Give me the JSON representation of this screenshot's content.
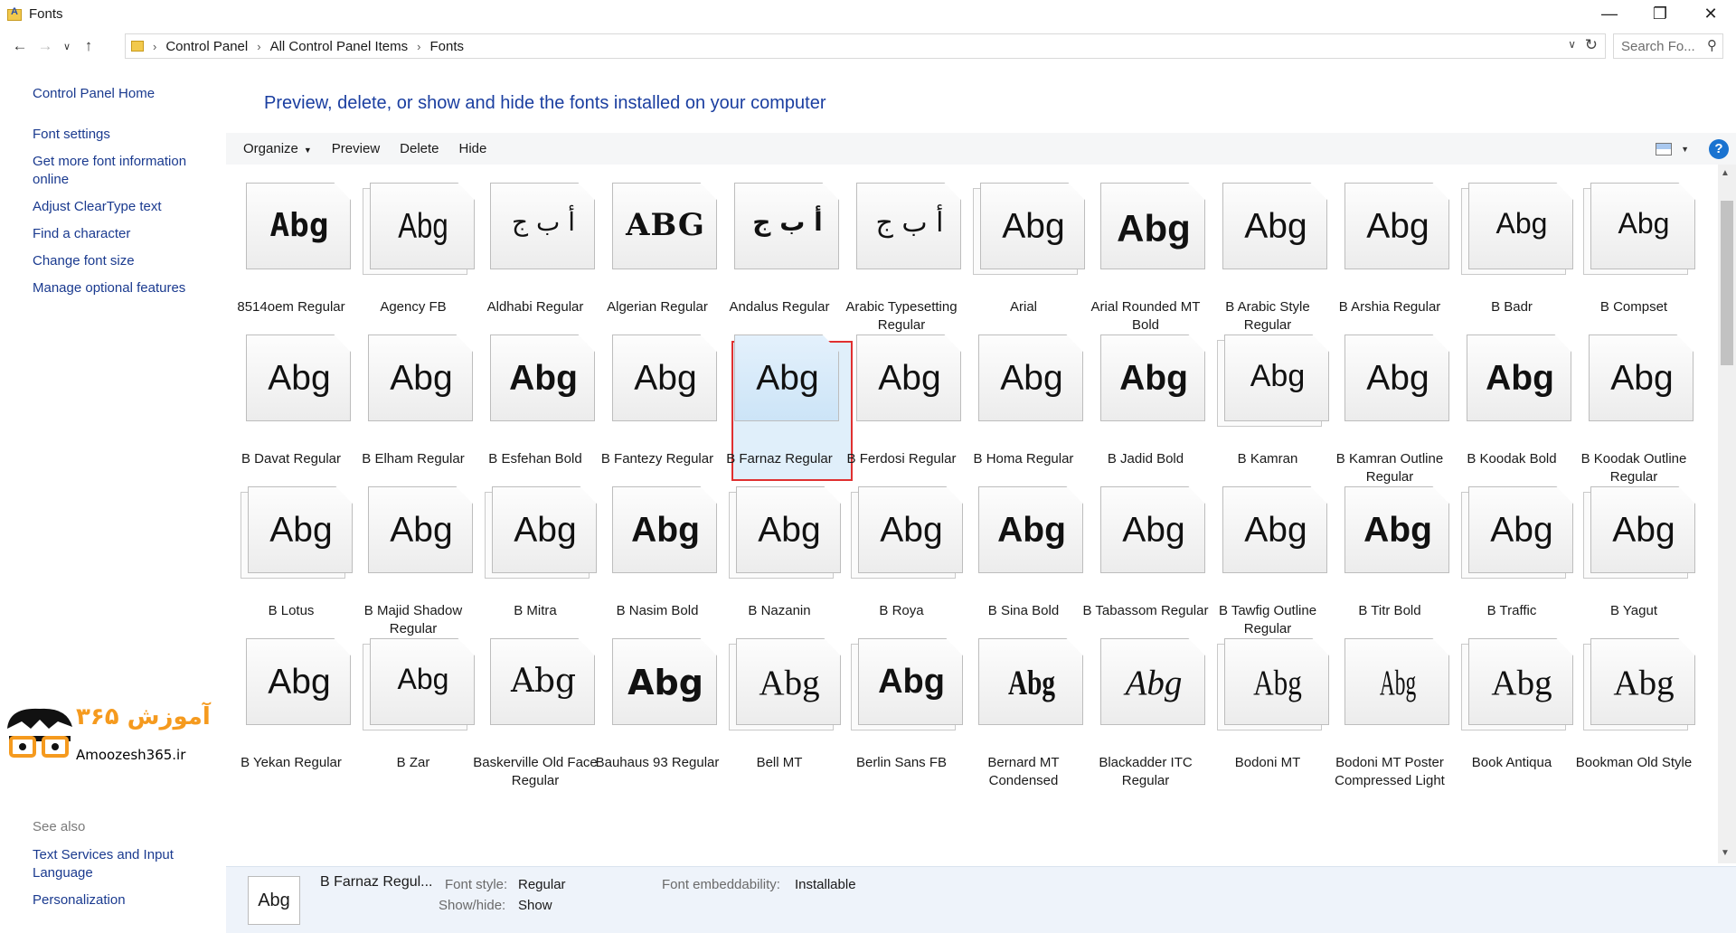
{
  "window": {
    "title": "Fonts"
  },
  "address": {
    "crumbs": [
      "Control Panel",
      "All Control Panel Items",
      "Fonts"
    ],
    "search_placeholder": "Search Fo..."
  },
  "leftnav": {
    "home": "Control Panel Home",
    "links": [
      "Font settings",
      "Get more font information online",
      "Adjust ClearType text",
      "Find a character",
      "Change font size",
      "Manage optional features"
    ],
    "see_also_label": "See also",
    "see_also": [
      "Text Services and Input Language",
      "Personalization"
    ]
  },
  "logo": {
    "text": "آموزش ۳۶۵",
    "url": "Amoozesh365.ir"
  },
  "main": {
    "heading": "Preview, delete, or show and hide the fonts installed on your computer",
    "toolbar": {
      "organize": "Organize",
      "preview": "Preview",
      "delete": "Delete",
      "hide": "Hide",
      "help": "?"
    }
  },
  "fonts": [
    {
      "name": "8514oem Regular",
      "sample": "Abg",
      "stack": false
    },
    {
      "name": "Agency FB",
      "sample": "Abg",
      "stack": true
    },
    {
      "name": "Aldhabi Regular",
      "sample": "أ ب ج",
      "stack": false
    },
    {
      "name": "Algerian Regular",
      "sample": "ABG",
      "stack": false
    },
    {
      "name": "Andalus Regular",
      "sample": "أ ب ج",
      "stack": false
    },
    {
      "name": "Arabic Typesetting Regular",
      "sample": "أ ب ج",
      "stack": false
    },
    {
      "name": "Arial",
      "sample": "Abg",
      "stack": true
    },
    {
      "name": "Arial Rounded MT Bold",
      "sample": "Abg",
      "stack": false
    },
    {
      "name": "B Arabic Style Regular",
      "sample": "Abg",
      "stack": false
    },
    {
      "name": "B Arshia Regular",
      "sample": "Abg",
      "stack": false
    },
    {
      "name": "B Badr",
      "sample": "Abg",
      "stack": true
    },
    {
      "name": "B Compset",
      "sample": "Abg",
      "stack": true
    },
    {
      "name": "B Davat Regular",
      "sample": "Abg",
      "stack": false
    },
    {
      "name": "B Elham Regular",
      "sample": "Abg",
      "stack": false
    },
    {
      "name": "B Esfehan Bold",
      "sample": "Abg",
      "stack": false
    },
    {
      "name": "B Fantezy Regular",
      "sample": "Abg",
      "stack": false
    },
    {
      "name": "B Farnaz Regular",
      "sample": "Abg",
      "stack": false
    },
    {
      "name": "B Ferdosi Regular",
      "sample": "Abg",
      "stack": false
    },
    {
      "name": "B Homa Regular",
      "sample": "Abg",
      "stack": false
    },
    {
      "name": "B Jadid Bold",
      "sample": "Abg",
      "stack": false
    },
    {
      "name": "B Kamran",
      "sample": "Abg",
      "stack": true
    },
    {
      "name": "B Kamran Outline Regular",
      "sample": "Abg",
      "stack": false
    },
    {
      "name": "B Koodak Bold",
      "sample": "Abg",
      "stack": false
    },
    {
      "name": "B Koodak Outline Regular",
      "sample": "Abg",
      "stack": false
    },
    {
      "name": "B Lotus",
      "sample": "Abg",
      "stack": true
    },
    {
      "name": "B Majid Shadow Regular",
      "sample": "Abg",
      "stack": false
    },
    {
      "name": "B Mitra",
      "sample": "Abg",
      "stack": true
    },
    {
      "name": "B Nasim Bold",
      "sample": "Abg",
      "stack": false
    },
    {
      "name": "B Nazanin",
      "sample": "Abg",
      "stack": true
    },
    {
      "name": "B Roya",
      "sample": "Abg",
      "stack": true
    },
    {
      "name": "B Sina Bold",
      "sample": "Abg",
      "stack": false
    },
    {
      "name": "B Tabassom Regular",
      "sample": "Abg",
      "stack": false
    },
    {
      "name": "B Tawfig Outline Regular",
      "sample": "Abg",
      "stack": false
    },
    {
      "name": "B Titr Bold",
      "sample": "Abg",
      "stack": false
    },
    {
      "name": "B Traffic",
      "sample": "Abg",
      "stack": true
    },
    {
      "name": "B Yagut",
      "sample": "Abg",
      "stack": true
    },
    {
      "name": "B Yekan Regular",
      "sample": "Abg",
      "stack": false
    },
    {
      "name": "B Zar",
      "sample": "Abg",
      "stack": true
    },
    {
      "name": "Baskerville Old Face Regular",
      "sample": "Abg",
      "stack": false
    },
    {
      "name": "Bauhaus 93 Regular",
      "sample": "Abg",
      "stack": false
    },
    {
      "name": "Bell MT",
      "sample": "Abg",
      "stack": true
    },
    {
      "name": "Berlin Sans FB",
      "sample": "Abg",
      "stack": true
    },
    {
      "name": "Bernard MT Condensed",
      "sample": "Abg",
      "stack": false
    },
    {
      "name": "Blackadder ITC Regular",
      "sample": "Abg",
      "stack": false
    },
    {
      "name": "Bodoni MT",
      "sample": "Abg",
      "stack": true
    },
    {
      "name": "Bodoni MT Poster Compressed Light",
      "sample": "Abg",
      "stack": false
    },
    {
      "name": "Book Antiqua",
      "sample": "Abg",
      "stack": true
    },
    {
      "name": "Bookman Old Style",
      "sample": "Abg",
      "stack": true
    }
  ],
  "details": {
    "sample": "Abg",
    "name": "B Farnaz Regul...",
    "font_style_label": "Font style:",
    "font_style": "Regular",
    "showhide_label": "Show/hide:",
    "showhide": "Show",
    "embed_label": "Font embeddability:",
    "embed": "Installable"
  }
}
